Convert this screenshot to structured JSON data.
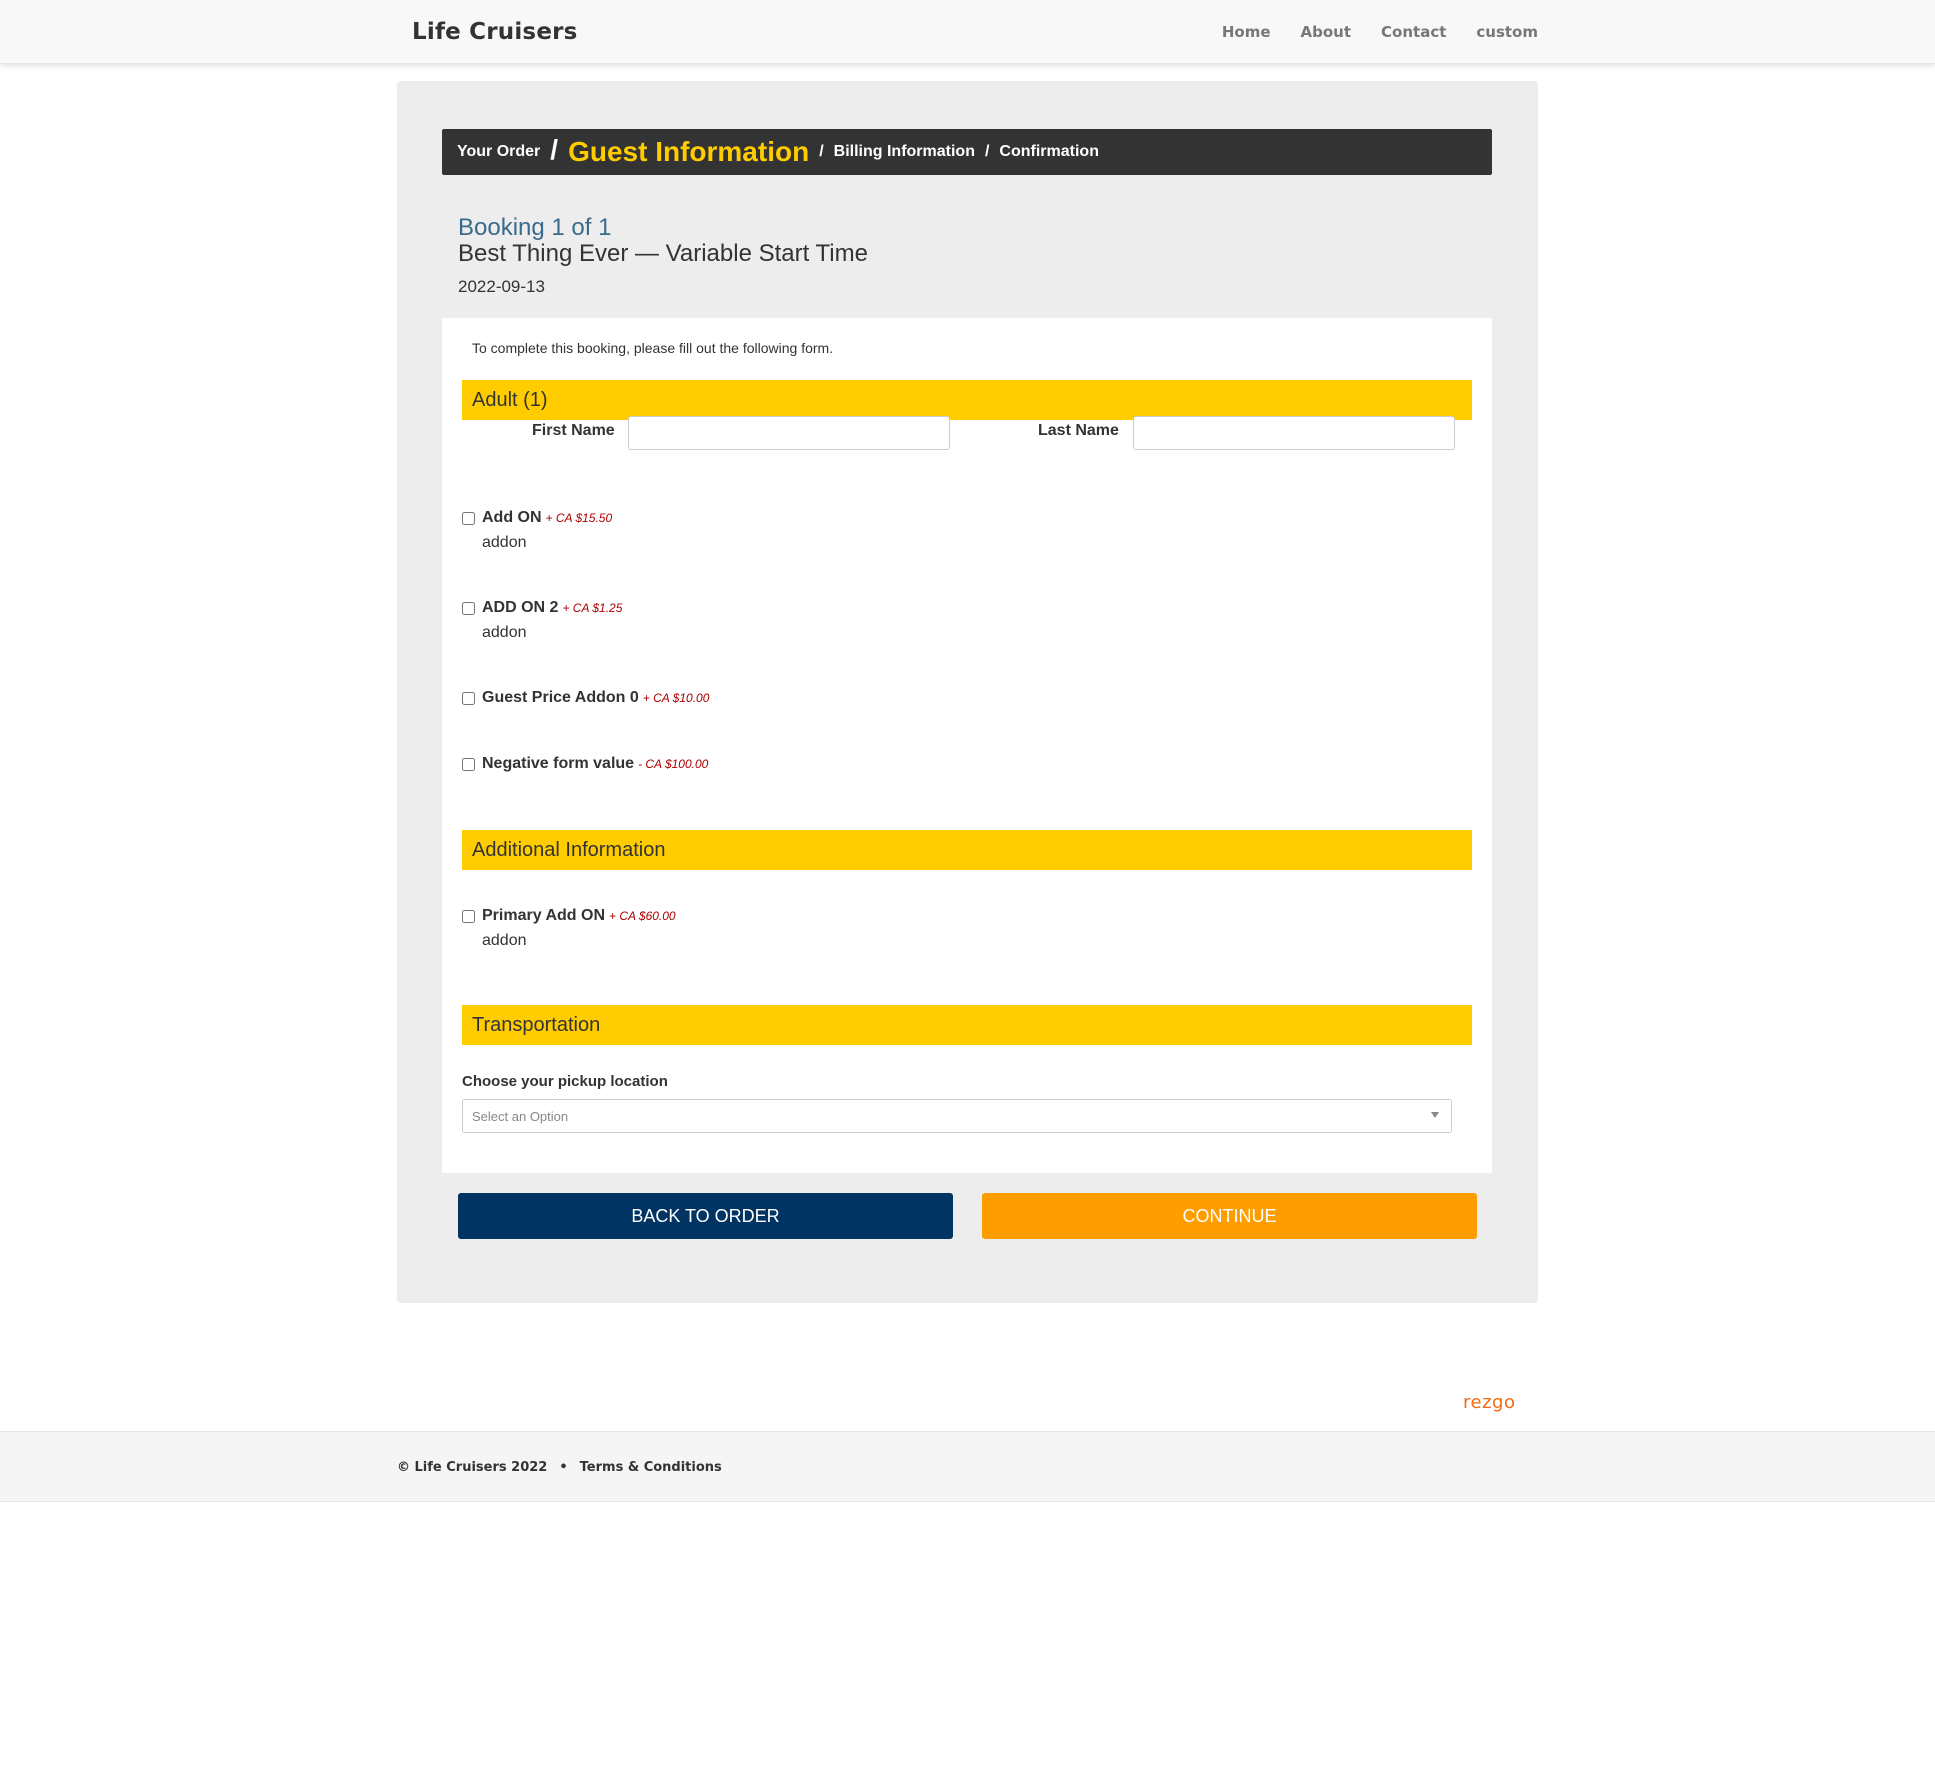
{
  "header": {
    "brand": "Life Cruisers",
    "nav": [
      "Home",
      "About",
      "Contact",
      "custom"
    ]
  },
  "breadcrumb": {
    "step1": "Your Order",
    "step2": "Guest Information",
    "step3": "Billing Information",
    "step4": "Confirmation",
    "separator": "/"
  },
  "booking": {
    "count": "Booking 1 of 1",
    "title": "Best Thing Ever — Variable Start Time",
    "date": "2022-09-13"
  },
  "form": {
    "intro": "To complete this booking, please fill out the following form.",
    "adult_section": "Adult (1)",
    "first_name_label": "First Name",
    "last_name_label": "Last Name",
    "first_name_value": "",
    "last_name_value": "",
    "addons": [
      {
        "name": "Add ON",
        "price": "+ CA $15.50",
        "desc": "addon"
      },
      {
        "name": "ADD ON 2",
        "price": "+ CA $1.25",
        "desc": "addon"
      },
      {
        "name": "Guest Price Addon 0",
        "price": "+ CA $10.00",
        "desc": ""
      },
      {
        "name": "Negative form value",
        "price": "- CA $100.00",
        "desc": ""
      }
    ],
    "additional_section": "Additional Information",
    "primary_addon": {
      "name": "Primary Add ON",
      "price": "+ CA $60.00",
      "desc": "addon"
    },
    "transport_section": "Transportation",
    "pickup_label": "Choose your pickup location",
    "pickup_placeholder": "Select an Option"
  },
  "buttons": {
    "back": "BACK TO ORDER",
    "continue": "CONTINUE"
  },
  "logo": "rezgo",
  "footer": {
    "copyright": "© Life Cruisers 2022",
    "dot": "•",
    "terms": "Terms & Conditions"
  },
  "colors": {
    "accent_yellow": "#ffcc00",
    "back_button": "#013462",
    "continue_button": "#ff9c00",
    "price_red": "#aa0000",
    "booking_blue": "#3a6b8c"
  }
}
